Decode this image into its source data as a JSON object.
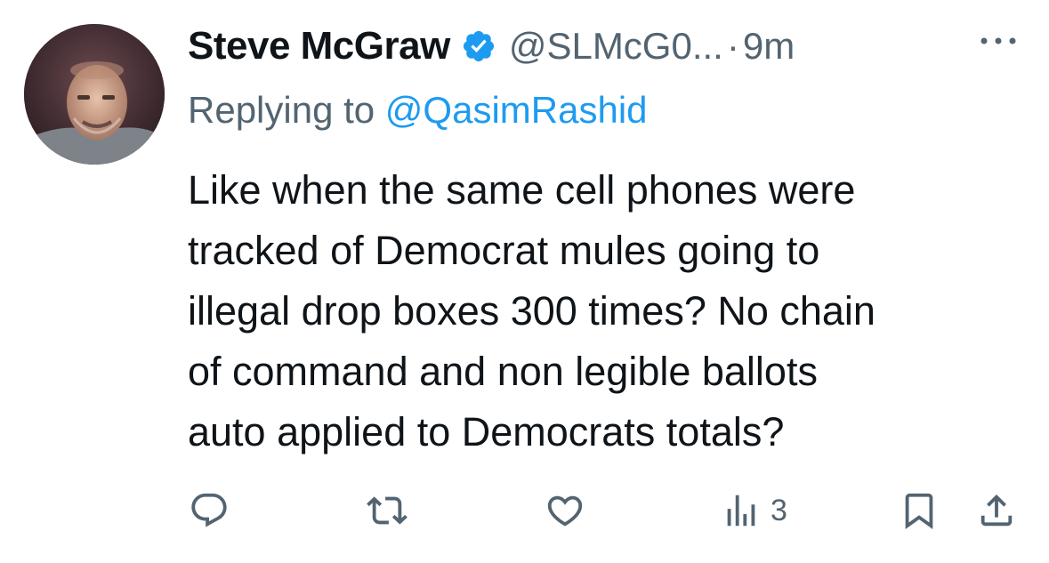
{
  "tweet": {
    "author_name": "Steve McGraw",
    "author_handle": "@SLMcG0...",
    "separator": "·",
    "time": "9m",
    "replying_prefix": "Replying to ",
    "replying_to": "@QasimRashid",
    "text_lines": [
      "Like when the same cell phones were",
      "tracked of Democrat mules going to",
      "illegal drop boxes 300 times? No chain",
      "of command and non legible ballots",
      "auto applied to Democrats totals?"
    ],
    "views_count": "3"
  },
  "icons": {
    "verified": "verified-badge-icon",
    "more": "more-options-icon",
    "reply": "reply-icon",
    "retweet": "retweet-icon",
    "like": "heart-icon",
    "views": "views-chart-icon",
    "bookmark": "bookmark-icon",
    "share": "share-icon"
  },
  "colors": {
    "text_primary": "#0f1419",
    "text_secondary": "#536471",
    "accent": "#1d9bf0"
  }
}
